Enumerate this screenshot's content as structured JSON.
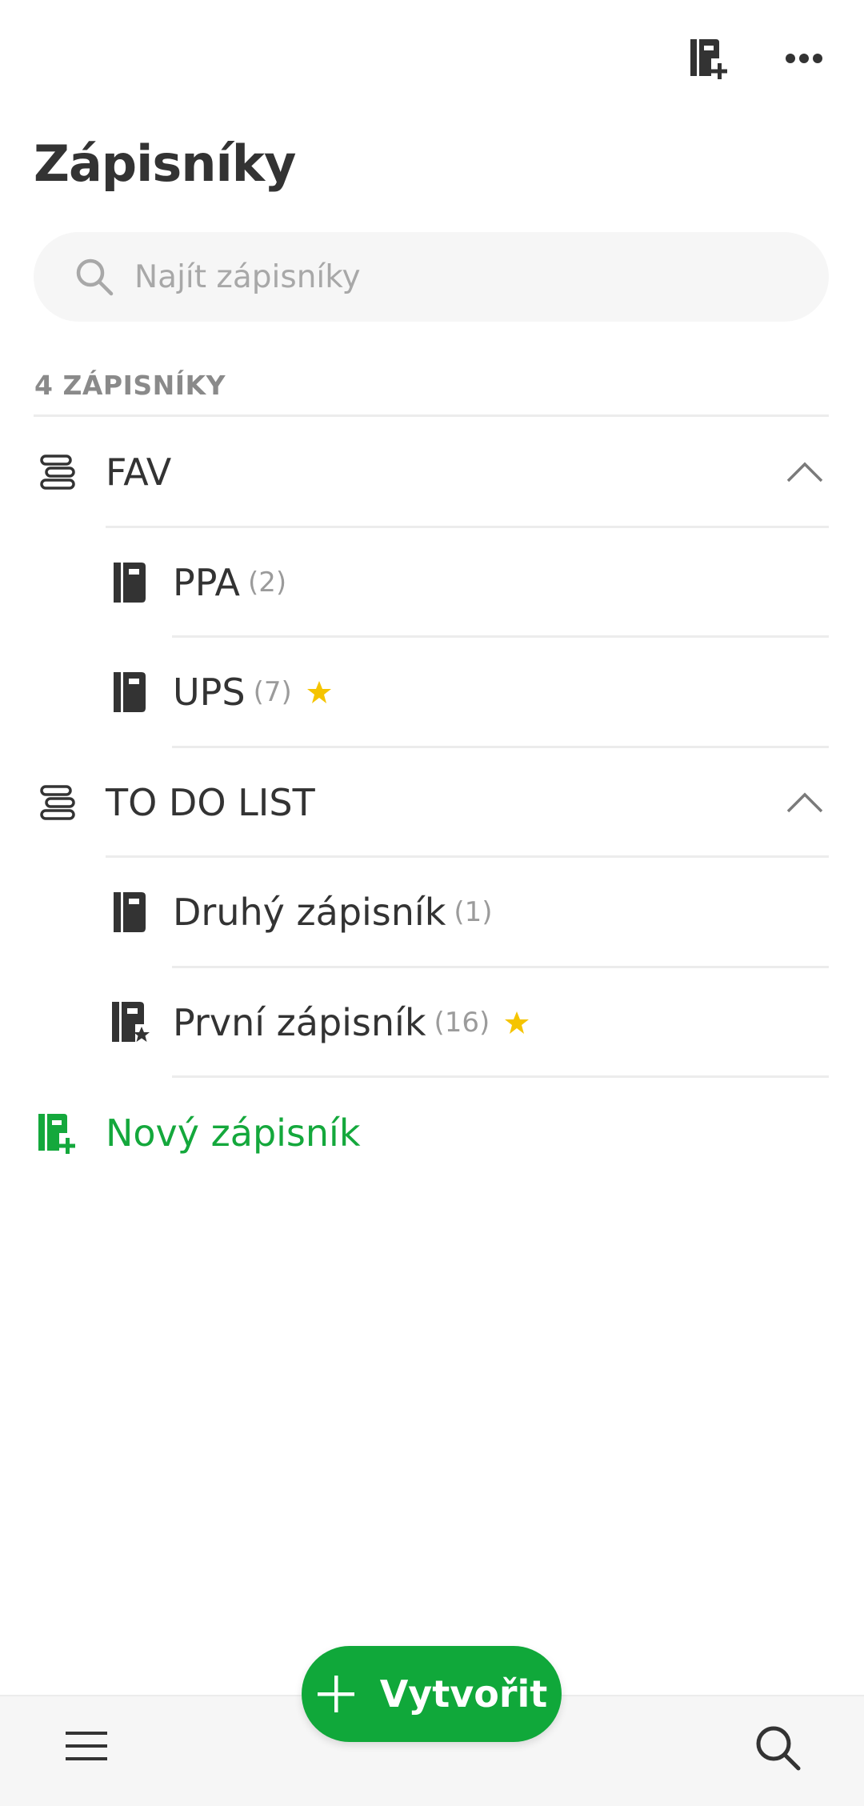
{
  "header": {
    "title": "Zápisníky",
    "new_notebook_icon": "new-notebook-icon",
    "more_icon": "more-horizontal-icon"
  },
  "search": {
    "placeholder": "Najít zápisníky",
    "icon": "search-icon"
  },
  "list": {
    "count_label": "4 ZÁPISNÍKY",
    "stacks": [
      {
        "label": "FAV",
        "icon": "stack-icon",
        "expanded": true,
        "notebooks": [
          {
            "label": "PPA",
            "count": "(2)",
            "shortcut": false,
            "icon": "notebook-icon"
          },
          {
            "label": "UPS",
            "count": "(7)",
            "shortcut": true,
            "icon": "notebook-icon"
          }
        ]
      },
      {
        "label": "TO DO LIST",
        "icon": "stack-icon",
        "expanded": true,
        "notebooks": [
          {
            "label": "Druhý zápisník",
            "count": "(1)",
            "shortcut": false,
            "icon": "notebook-icon"
          },
          {
            "label": "První zápisník",
            "count": "(16)",
            "shortcut": true,
            "icon": "default-notebook-icon"
          }
        ]
      }
    ],
    "new_notebook_label": "Nový zápisník"
  },
  "fab": {
    "label": "Vytvořit",
    "icon": "plus-icon"
  },
  "bottom_nav": {
    "menu_icon": "hamburger-menu-icon",
    "search_icon": "search-icon"
  },
  "colors": {
    "accent": "#10a83a",
    "star": "#f5c400",
    "text": "#333333",
    "muted": "#9b9b9b",
    "divider": "#ececec"
  }
}
